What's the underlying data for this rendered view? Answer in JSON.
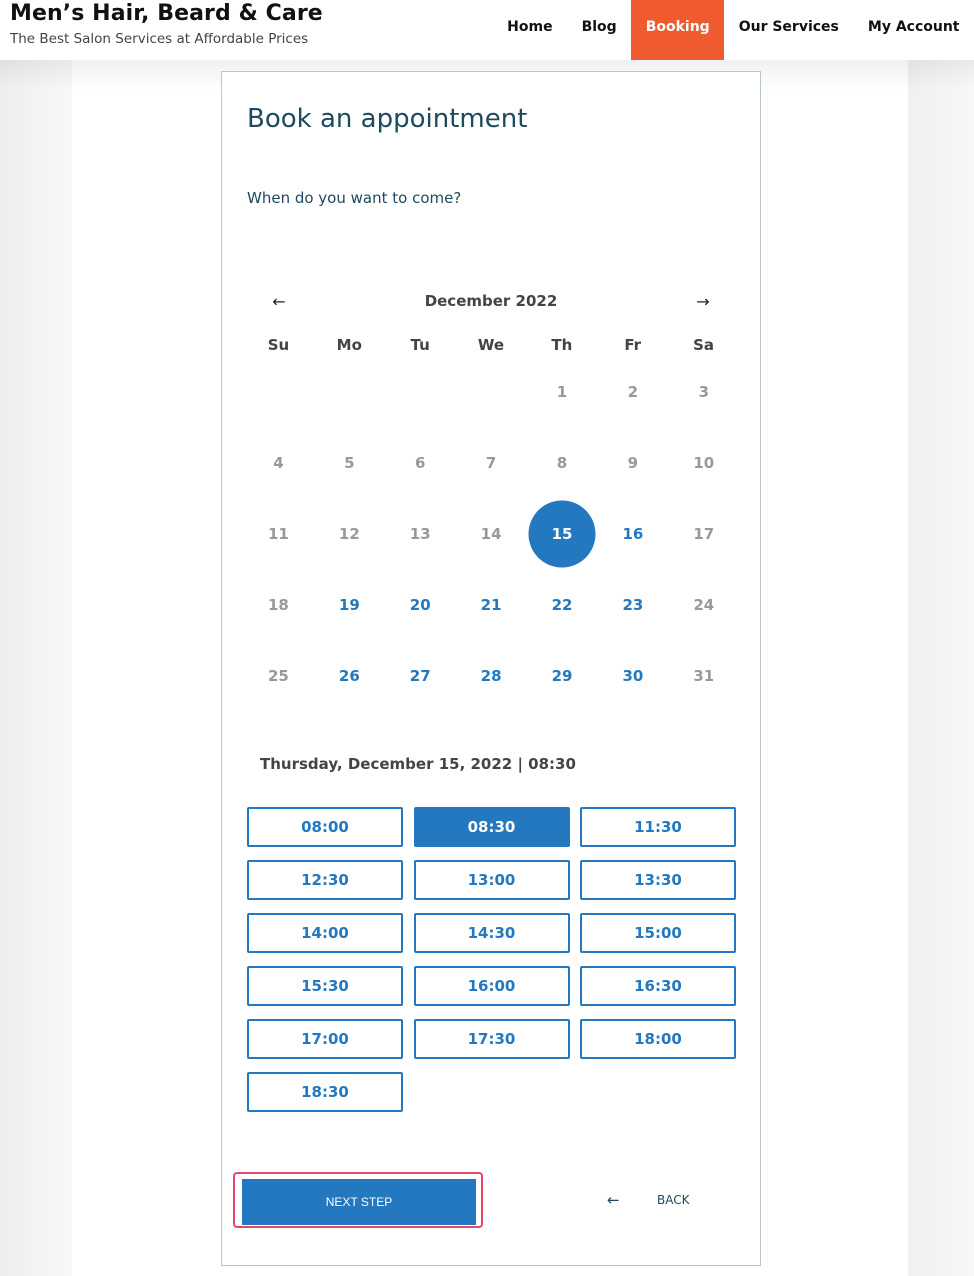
{
  "header": {
    "site_title": "Men’s Hair, Beard & Care",
    "tagline": "The Best Salon Services at Affordable Prices",
    "nav": [
      {
        "label": "Home",
        "active": false
      },
      {
        "label": "Blog",
        "active": false
      },
      {
        "label": "Booking",
        "active": true
      },
      {
        "label": "Our Services",
        "active": false
      },
      {
        "label": "My Account",
        "active": false
      }
    ]
  },
  "booking": {
    "title": "Book an appointment",
    "question": "When do you want to come?",
    "calendar": {
      "month_label": "December 2022",
      "prev_icon": "arrow-left-icon",
      "next_icon": "arrow-right-icon",
      "weekdays": [
        "Su",
        "Mo",
        "Tu",
        "We",
        "Th",
        "Fr",
        "Sa"
      ],
      "leading_blanks": 4,
      "days": [
        {
          "d": "1",
          "state": "unavailable"
        },
        {
          "d": "2",
          "state": "unavailable"
        },
        {
          "d": "3",
          "state": "unavailable"
        },
        {
          "d": "4",
          "state": "unavailable"
        },
        {
          "d": "5",
          "state": "unavailable"
        },
        {
          "d": "6",
          "state": "unavailable"
        },
        {
          "d": "7",
          "state": "unavailable"
        },
        {
          "d": "8",
          "state": "unavailable"
        },
        {
          "d": "9",
          "state": "unavailable"
        },
        {
          "d": "10",
          "state": "unavailable"
        },
        {
          "d": "11",
          "state": "unavailable"
        },
        {
          "d": "12",
          "state": "unavailable"
        },
        {
          "d": "13",
          "state": "unavailable"
        },
        {
          "d": "14",
          "state": "unavailable"
        },
        {
          "d": "15",
          "state": "selected"
        },
        {
          "d": "16",
          "state": "available"
        },
        {
          "d": "17",
          "state": "unavailable"
        },
        {
          "d": "18",
          "state": "unavailable"
        },
        {
          "d": "19",
          "state": "available"
        },
        {
          "d": "20",
          "state": "available"
        },
        {
          "d": "21",
          "state": "available"
        },
        {
          "d": "22",
          "state": "available"
        },
        {
          "d": "23",
          "state": "available"
        },
        {
          "d": "24",
          "state": "unavailable"
        },
        {
          "d": "25",
          "state": "unavailable"
        },
        {
          "d": "26",
          "state": "available"
        },
        {
          "d": "27",
          "state": "available"
        },
        {
          "d": "28",
          "state": "available"
        },
        {
          "d": "29",
          "state": "available"
        },
        {
          "d": "30",
          "state": "available"
        },
        {
          "d": "31",
          "state": "unavailable"
        }
      ]
    },
    "selection_summary": "Thursday, December 15, 2022 | 08:30",
    "time_slots": [
      {
        "time": "08:00",
        "selected": false
      },
      {
        "time": "08:30",
        "selected": true
      },
      {
        "time": "11:30",
        "selected": false
      },
      {
        "time": "12:30",
        "selected": false
      },
      {
        "time": "13:00",
        "selected": false
      },
      {
        "time": "13:30",
        "selected": false
      },
      {
        "time": "14:00",
        "selected": false
      },
      {
        "time": "14:30",
        "selected": false
      },
      {
        "time": "15:00",
        "selected": false
      },
      {
        "time": "15:30",
        "selected": false
      },
      {
        "time": "16:00",
        "selected": false
      },
      {
        "time": "16:30",
        "selected": false
      },
      {
        "time": "17:00",
        "selected": false
      },
      {
        "time": "17:30",
        "selected": false
      },
      {
        "time": "18:00",
        "selected": false
      },
      {
        "time": "18:30",
        "selected": false
      }
    ],
    "next_label": "NEXT STEP",
    "back_label": "BACK",
    "back_icon": "arrow-left-icon"
  },
  "colors": {
    "accent": "#2378bf",
    "nav_active": "#ef5a2f",
    "heading": "#1e4a5e",
    "highlight_outline": "#e6476a"
  }
}
